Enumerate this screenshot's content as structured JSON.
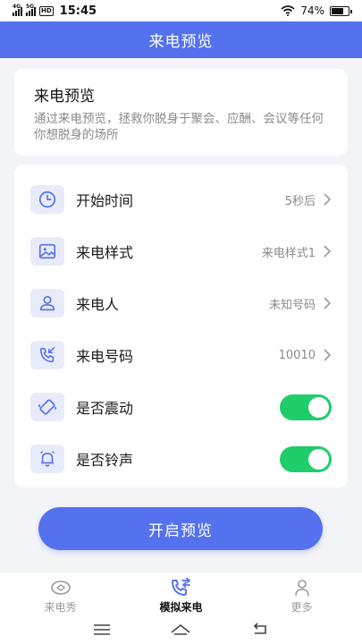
{
  "status_bar": {
    "network_1": "4G",
    "network_2": "5G",
    "hd": "HD",
    "time": "15:45",
    "battery_text": "74%",
    "battery_level": 0.74,
    "wifi_icon": "wifi-icon"
  },
  "header": {
    "title": "来电预览"
  },
  "intro": {
    "title": "来电预览",
    "description": "通过来电预览，拯救你脱身于聚会、应酬、会议等任何你想脱身的场所"
  },
  "settings": {
    "rows": [
      {
        "label": "开始时间",
        "value": "5秒后",
        "icon": "clock-icon"
      },
      {
        "label": "来电样式",
        "value": "来电样式1",
        "icon": "image-icon"
      },
      {
        "label": "来电人",
        "value": "未知号码",
        "icon": "user-icon"
      },
      {
        "label": "来电号码",
        "value": "10010",
        "icon": "phone-incoming-icon"
      },
      {
        "label": "是否震动",
        "enabled": true,
        "icon": "vibrate-icon"
      },
      {
        "label": "是否铃声",
        "enabled": true,
        "icon": "bell-icon"
      }
    ]
  },
  "start_button": {
    "label": "开启预览"
  },
  "tabs": [
    {
      "label": "来电秀",
      "icon": "eye-icon",
      "active": false
    },
    {
      "label": "模拟来电",
      "icon": "phone-swap-icon",
      "active": true
    },
    {
      "label": "更多",
      "icon": "person-icon",
      "active": false
    }
  ],
  "colors": {
    "primary": "#5471ee",
    "toggle_on": "#1fcd6a",
    "icon_bg": "#e8ebfb",
    "background": "#f3f4f8"
  }
}
